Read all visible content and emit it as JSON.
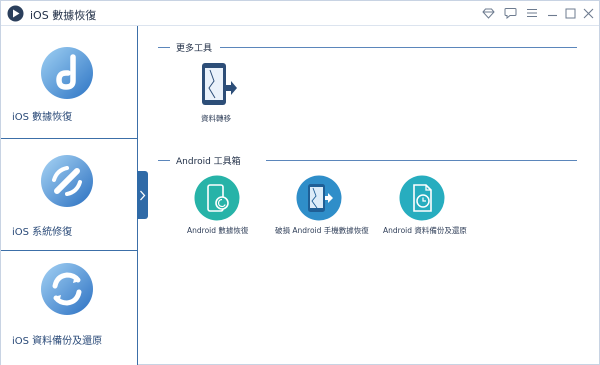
{
  "app": {
    "title": "iOS 數據恢復"
  },
  "titlebar": {
    "icons": [
      "diamond-icon",
      "chat-icon",
      "menu-icon",
      "minimize-icon",
      "maximize-icon",
      "close-icon"
    ]
  },
  "sidebar": {
    "items": [
      {
        "label": "iOS 數據恢復",
        "icon": "data-recovery-logo-icon"
      },
      {
        "label": "iOS 系統修復",
        "icon": "system-repair-logo-icon"
      },
      {
        "label": "iOS 資料備份及還原",
        "icon": "backup-restore-logo-icon"
      }
    ]
  },
  "main": {
    "more_tools": {
      "title": "更多工具",
      "items": [
        {
          "label": "資料轉移",
          "icon": "phone-transfer-icon"
        }
      ]
    },
    "android_toolbox": {
      "title": "Android 工具箱",
      "items": [
        {
          "label": "Android 數據恢復",
          "icon": "android-recovery-icon",
          "color": "#27b3a8"
        },
        {
          "label": "破損 Android 手機數據恢復",
          "icon": "broken-phone-recovery-icon",
          "color": "#2f8ec9"
        },
        {
          "label": "Android 資料備份及還原",
          "icon": "android-backup-icon",
          "color": "#27adbf"
        }
      ]
    }
  },
  "colors": {
    "accent": "#2f6aa7",
    "divider": "#5b86bb",
    "teal": "#27b3a8",
    "blue": "#2f8ec9"
  }
}
